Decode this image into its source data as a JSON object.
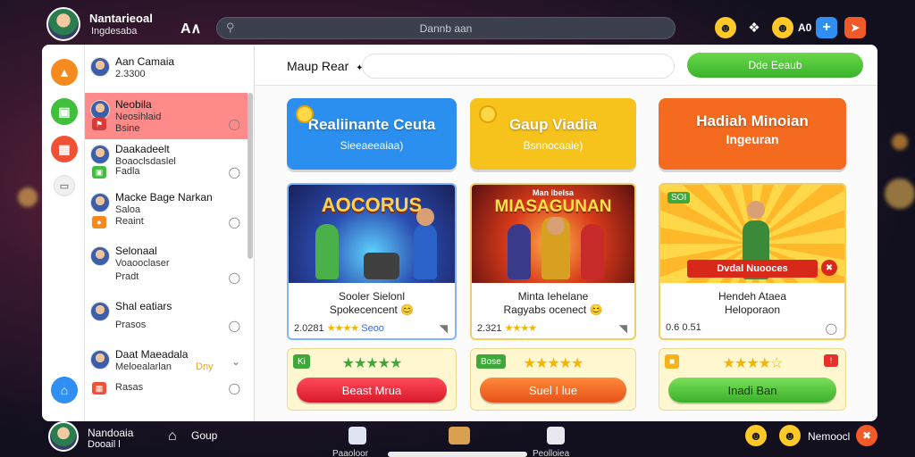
{
  "topbar": {
    "user_name": "Nantarieoal",
    "user_sub": "Ingdesaba",
    "brand_mark": "A∧",
    "search_value": "Dannb aan",
    "right_label": "A0"
  },
  "sidebar": {
    "contacts": [
      {
        "name": "Aan Camaia",
        "line2": "2.3300",
        "line3": ""
      },
      {
        "name": "Neobila",
        "line2": "Neosihlaid",
        "line3": "Bsine"
      },
      {
        "name": "Daakadeelt",
        "line2": "Boaoclsdaslel",
        "line3": "Fadla"
      },
      {
        "name": "Macke Bage Narkan",
        "line2": "Saloa",
        "line3": "Reaint"
      },
      {
        "name": "Selonaal",
        "line2": "Voaooclaser",
        "line3": "Pradt"
      },
      {
        "name": "Shal eatiars",
        "line2": "Prasos",
        "line3": ""
      },
      {
        "name": "Daat Maeadala",
        "line2": "Meloealarlan",
        "line3": "Rasas"
      }
    ],
    "extra_tag": "Dny"
  },
  "main": {
    "title": "Maup Rear",
    "title_arrow": "✦",
    "action_button": "Dde Eeaub",
    "banners": [
      {
        "title": "Realiinante Ceuta",
        "sub": "Sieeaeeaiaa)",
        "color": "#2b8ff0"
      },
      {
        "title": "Gaup Viadia",
        "sub": "Bsnnocaaie)",
        "color": "#f6c21c"
      },
      {
        "title": "Hadiah Minoian",
        "sub": "Ingeuran",
        "color": "#f46a1e"
      }
    ],
    "cards": [
      {
        "art_title": "AOCORUS",
        "title": "Sooler Sielonl",
        "sub": "Spokecencent 😊",
        "stat": "2.0281",
        "stars": "★★★★",
        "extra": "Seoo"
      },
      {
        "art_title": "MIASAGUNAN",
        "art_sub": "Man ibelsa",
        "title": "Minta Iehelane",
        "sub": "Ragyabs ocenect 😊",
        "stat": "2.321",
        "stars": "★★★★",
        "extra": ""
      },
      {
        "art_title": "",
        "ribbon": "Dvdal Nuooces",
        "corner": "SOI",
        "title": "Hendeh Ataea",
        "sub": "Heloporaon",
        "stat": "0.6 0.51",
        "stars": "",
        "extra": ""
      }
    ],
    "actions": [
      {
        "badge": "Ki",
        "stars": "★★★★★",
        "label": "Beast Mrua"
      },
      {
        "badge": "Bose",
        "stars": "★★★★★",
        "label": "Suel I lue"
      },
      {
        "badge": "",
        "stars": "★★★★☆",
        "label": "Inadi Ban"
      }
    ]
  },
  "bottombar": {
    "user_name": "Nandoaia",
    "user_sub": "Dooail l",
    "group_label": "Goup",
    "dock": [
      "Paaoloor",
      "",
      "Peolloiea"
    ],
    "right_label": "Nemoocl"
  }
}
